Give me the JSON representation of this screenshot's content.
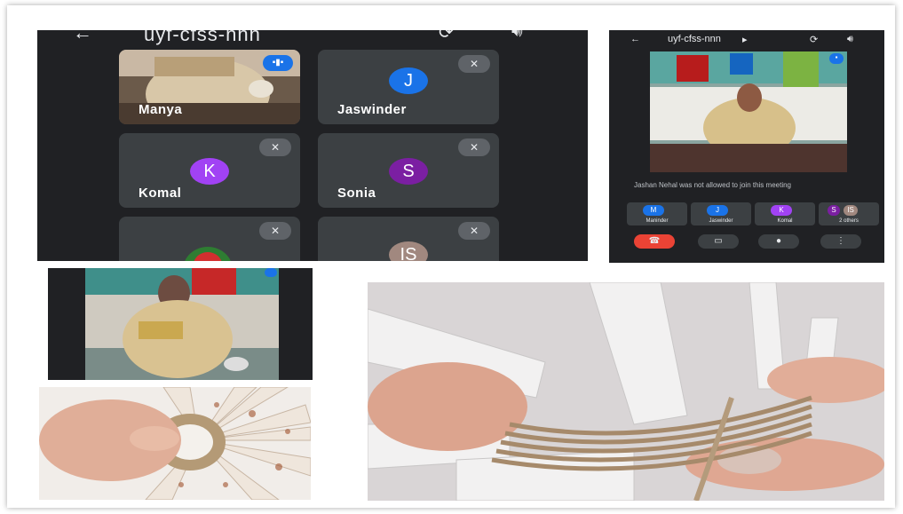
{
  "meet_grid": {
    "title": "uyf-cfss-nnn",
    "back_icon": "arrow-left-icon",
    "participants": [
      {
        "name": "Manya",
        "initial": "",
        "color": ""
      },
      {
        "name": "Jaswinder",
        "initial": "J",
        "color": "#1a73e8"
      },
      {
        "name": "Komal",
        "initial": "K",
        "color": "#a142f4"
      },
      {
        "name": "Sonia",
        "initial": "S",
        "color": "#7b1fa2"
      },
      {
        "name": "",
        "initial": "",
        "color": ""
      },
      {
        "name": "",
        "initial": "IS",
        "color": "#a1887f"
      }
    ]
  },
  "meet_single": {
    "title": "uyf-cfss-nnn",
    "notice": "Jashan Nehal was not allowed to join this meeting",
    "chips": [
      {
        "initial": "M",
        "label": "Maninder",
        "color": "#1a73e8"
      },
      {
        "initial": "J",
        "label": "Jaswinder",
        "color": "#1a73e8"
      },
      {
        "initial": "K",
        "label": "Komal",
        "color": "#a142f4"
      },
      {
        "initial": "S",
        "initial2": "IS",
        "label": "2 others",
        "color": "#7b1fa2"
      }
    ]
  },
  "colors": {
    "meet_bg": "#202124",
    "tile_bg": "#3c4043",
    "end_call": "#ea4335"
  }
}
